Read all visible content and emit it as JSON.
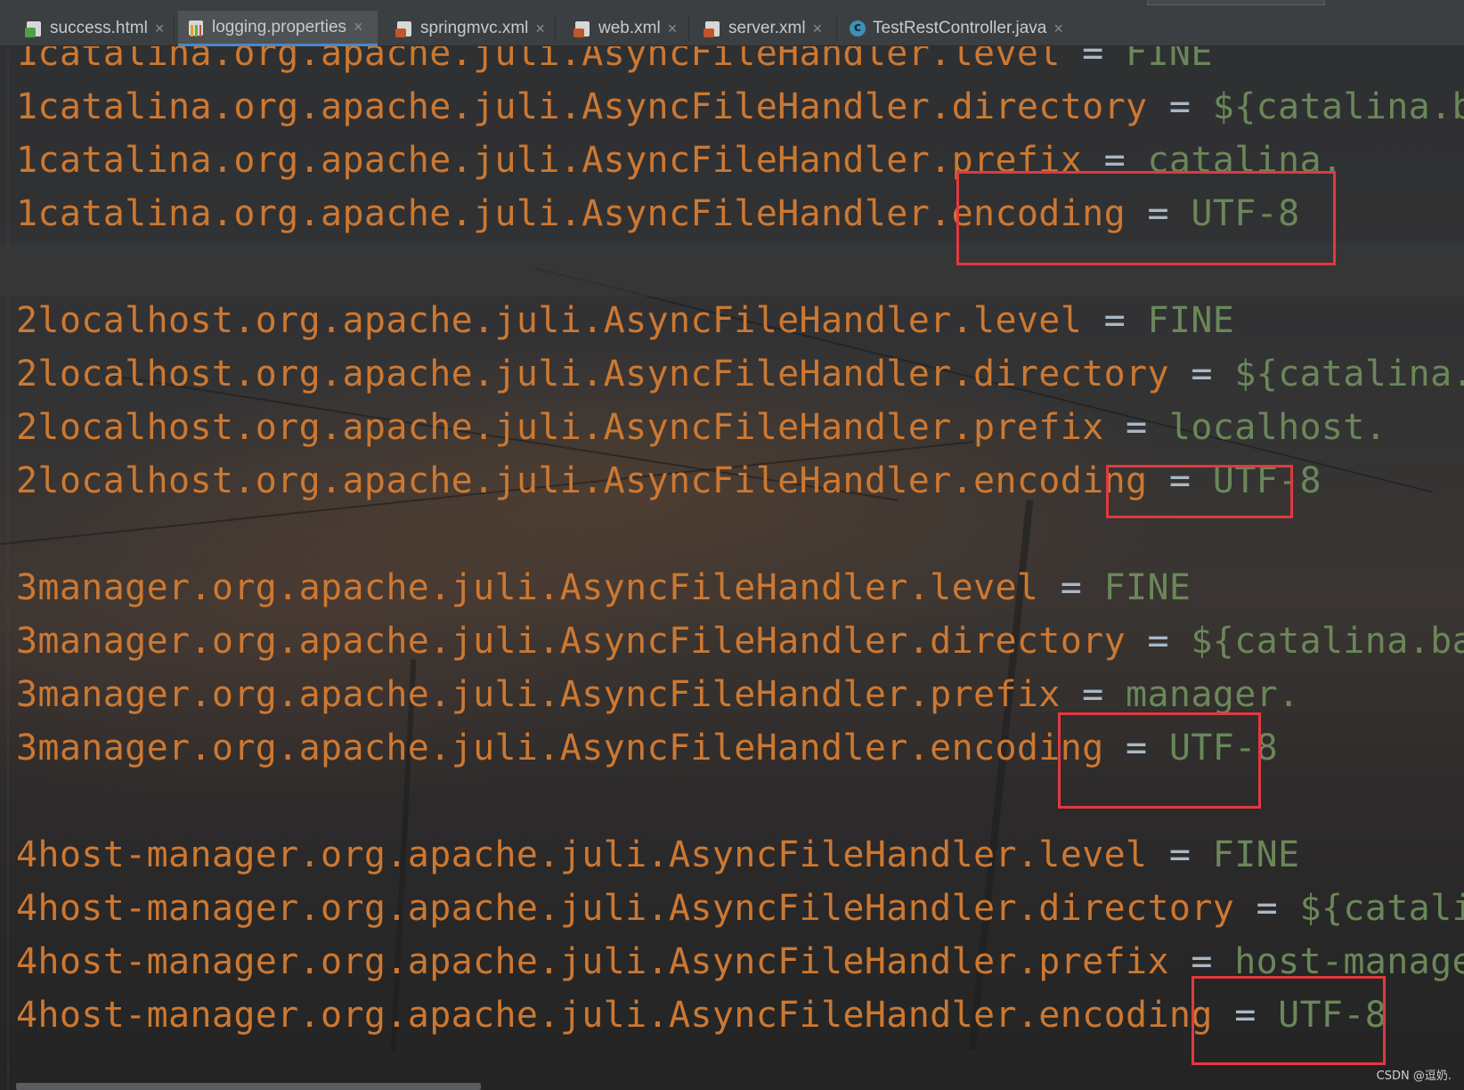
{
  "tabs": [
    {
      "label": "success.html",
      "icon": "html-file-icon"
    },
    {
      "label": "logging.properties",
      "icon": "properties-file-icon",
      "active": true
    },
    {
      "label": "springmvc.xml",
      "icon": "xml-file-icon"
    },
    {
      "label": "web.xml",
      "icon": "xml-file-icon"
    },
    {
      "label": "server.xml",
      "icon": "xml-file-icon"
    },
    {
      "label": "TestRestController.java",
      "icon": "java-class-icon"
    }
  ],
  "lines": [
    {
      "key": "1catalina.org.apache.juli.AsyncFileHandler.level",
      "eq": " = ",
      "value": "FINE"
    },
    {
      "key": "1catalina.org.apache.juli.AsyncFileHandler.directory",
      "eq": " = ",
      "value": "${catalina.base}"
    },
    {
      "key": "1catalina.org.apache.juli.AsyncFileHandler.prefix",
      "eq": " = ",
      "value": "catalina."
    },
    {
      "key": "1catalina.org.apache.juli.AsyncFileHandler.encoding",
      "eq": " = ",
      "value": "UTF-8"
    },
    {
      "key": "",
      "eq": "",
      "value": ""
    },
    {
      "key": "2localhost.org.apache.juli.AsyncFileHandler.level",
      "eq": " = ",
      "value": "FINE"
    },
    {
      "key": "2localhost.org.apache.juli.AsyncFileHandler.directory",
      "eq": " = ",
      "value": "${catalina.base"
    },
    {
      "key": "2localhost.org.apache.juli.AsyncFileHandler.prefix",
      "eq": " = ",
      "value": "localhost."
    },
    {
      "key": "2localhost.org.apache.juli.AsyncFileHandler.encoding",
      "eq": " = ",
      "value": "UTF-8"
    },
    {
      "key": "",
      "eq": "",
      "value": ""
    },
    {
      "key": "3manager.org.apache.juli.AsyncFileHandler.level",
      "eq": " = ",
      "value": "FINE"
    },
    {
      "key": "3manager.org.apache.juli.AsyncFileHandler.directory",
      "eq": " = ",
      "value": "${catalina.base}/"
    },
    {
      "key": "3manager.org.apache.juli.AsyncFileHandler.prefix",
      "eq": " = ",
      "value": "manager."
    },
    {
      "key": "3manager.org.apache.juli.AsyncFileHandler.encoding",
      "eq": " = ",
      "value": "UTF-8"
    },
    {
      "key": "",
      "eq": "",
      "value": ""
    },
    {
      "key": "4host-manager.org.apache.juli.AsyncFileHandler.level",
      "eq": " = ",
      "value": "FINE"
    },
    {
      "key": "4host-manager.org.apache.juli.AsyncFileHandler.directory",
      "eq": " = ",
      "value": "${catalina.b"
    },
    {
      "key": "4host-manager.org.apache.juli.AsyncFileHandler.prefix",
      "eq": " = ",
      "value": "host-manager."
    },
    {
      "key": "4host-manager.org.apache.juli.AsyncFileHandler.encoding",
      "eq": " = ",
      "value": "UTF-8"
    }
  ],
  "colors": {
    "key": "#cc7832",
    "value": "#6a8759",
    "highlight_box": "#e1393f"
  },
  "watermark": "CSDN @逗奶."
}
